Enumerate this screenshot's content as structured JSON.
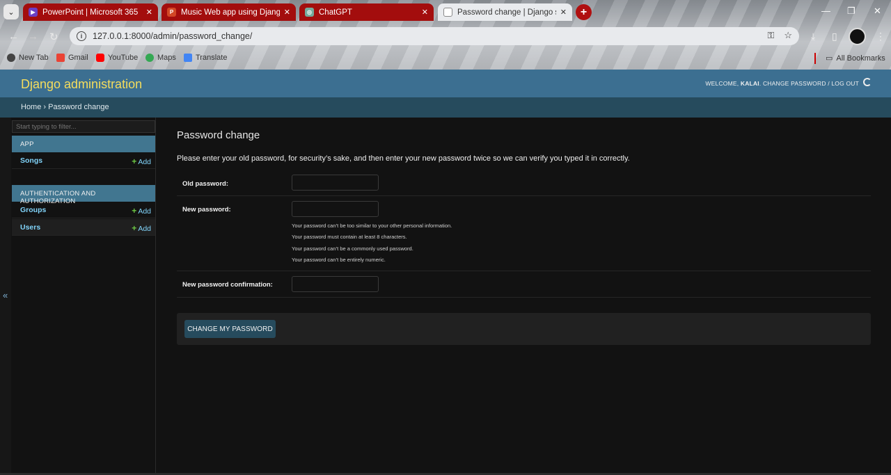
{
  "browser": {
    "tabs": [
      {
        "title": "PowerPoint | Microsoft 365",
        "style": "red",
        "favicon_color": "#6b3fc4"
      },
      {
        "title": "Music Web app using Django Fr",
        "style": "red",
        "favicon_color": "#d24726"
      },
      {
        "title": "ChatGPT",
        "style": "red",
        "favicon_color": "#74aa9c"
      },
      {
        "title": "Password change | Django site",
        "style": "active",
        "favicon_color": "#ffffff"
      }
    ],
    "url": "127.0.0.1:8000/admin/password_change/",
    "bookmarks": [
      {
        "label": "New Tab",
        "color": "#444"
      },
      {
        "label": "Gmail",
        "color": "#ea4335"
      },
      {
        "label": "YouTube",
        "color": "#ff0000"
      },
      {
        "label": "Maps",
        "color": "#34a853"
      },
      {
        "label": "Translate",
        "color": "#4285f4"
      }
    ],
    "all_bookmarks_label": "All Bookmarks"
  },
  "header": {
    "brand": "Django administration",
    "welcome": "WELCOME,",
    "username": "KALAI",
    "change_password": "CHANGE PASSWORD",
    "separator": "/",
    "logout": "LOG OUT"
  },
  "breadcrumbs": {
    "home": "Home",
    "sep": "›",
    "current": "Password change"
  },
  "sidebar": {
    "filter_placeholder": "Start typing to filter...",
    "toggle": "«",
    "modules": [
      {
        "caption": "APP",
        "items": [
          {
            "label": "Songs",
            "add": "Add"
          }
        ]
      },
      {
        "caption": "AUTHENTICATION AND AUTHORIZATION",
        "items": [
          {
            "label": "Groups",
            "add": "Add"
          },
          {
            "label": "Users",
            "add": "Add"
          }
        ]
      }
    ],
    "plus": "+"
  },
  "main": {
    "title": "Password change",
    "intro": "Please enter your old password, for security’s sake, and then enter your new password twice so we can verify you typed it in correctly.",
    "fields": {
      "old": "Old password:",
      "new": "New password:",
      "confirm": "New password confirmation:"
    },
    "help": [
      "Your password can’t be too similar to your other personal information.",
      "Your password must contain at least 8 characters.",
      "Your password can’t be a commonly used password.",
      "Your password can’t be entirely numeric."
    ],
    "submit": "CHANGE MY PASSWORD"
  }
}
